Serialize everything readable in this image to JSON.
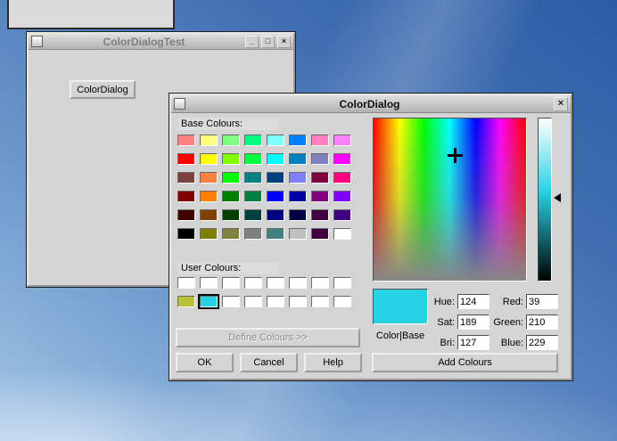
{
  "test_window": {
    "title": "ColorDialogTest",
    "color_dialog_button": "ColorDialog",
    "minimize_icon": "_",
    "maximize_icon": "□",
    "close_icon": "×"
  },
  "dialog": {
    "title": "ColorDialog",
    "close_icon": "×",
    "base_colors_label": "Base Colours:",
    "user_colors_label": "User Colours:",
    "define_colors_button": "Define Colours >>",
    "ok_button": "OK",
    "cancel_button": "Cancel",
    "help_button": "Help",
    "add_colors_button": "Add Colours",
    "color_base_label": "Color|Base",
    "selected_color": "#27d2e5",
    "selected_user_index": 9,
    "base_colors": [
      "#ff8080",
      "#ffff80",
      "#80ff80",
      "#00ff80",
      "#80ffff",
      "#0080ff",
      "#ff80c0",
      "#ff80ff",
      "#ff0000",
      "#ffff00",
      "#80ff00",
      "#00ff40",
      "#00ffff",
      "#0080c0",
      "#8080c0",
      "#ff00ff",
      "#804040",
      "#ff8040",
      "#00ff00",
      "#008080",
      "#004080",
      "#8080ff",
      "#800040",
      "#ff0080",
      "#800000",
      "#ff8000",
      "#008000",
      "#008040",
      "#0000ff",
      "#0000a0",
      "#800080",
      "#8000ff",
      "#400000",
      "#804000",
      "#004000",
      "#004040",
      "#000080",
      "#000040",
      "#400040",
      "#400080",
      "#000000",
      "#808000",
      "#808040",
      "#808080",
      "#408080",
      "#c0c0c0",
      "#400040",
      "#ffffff"
    ],
    "user_colors": [
      "#ffffff",
      "#ffffff",
      "#ffffff",
      "#ffffff",
      "#ffffff",
      "#ffffff",
      "#ffffff",
      "#ffffff",
      "#b8c234",
      "#27d2e5",
      "#ffffff",
      "#ffffff",
      "#ffffff",
      "#ffffff",
      "#ffffff",
      "#ffffff"
    ],
    "fields": {
      "hue": {
        "label": "Hue:",
        "value": "124"
      },
      "sat": {
        "label": "Sat:",
        "value": "189"
      },
      "bri": {
        "label": "Bri:",
        "value": "127"
      },
      "red": {
        "label": "Red:",
        "value": "39"
      },
      "green": {
        "label": "Green:",
        "value": "210"
      },
      "blue": {
        "label": "Blue:",
        "value": "229"
      }
    }
  }
}
